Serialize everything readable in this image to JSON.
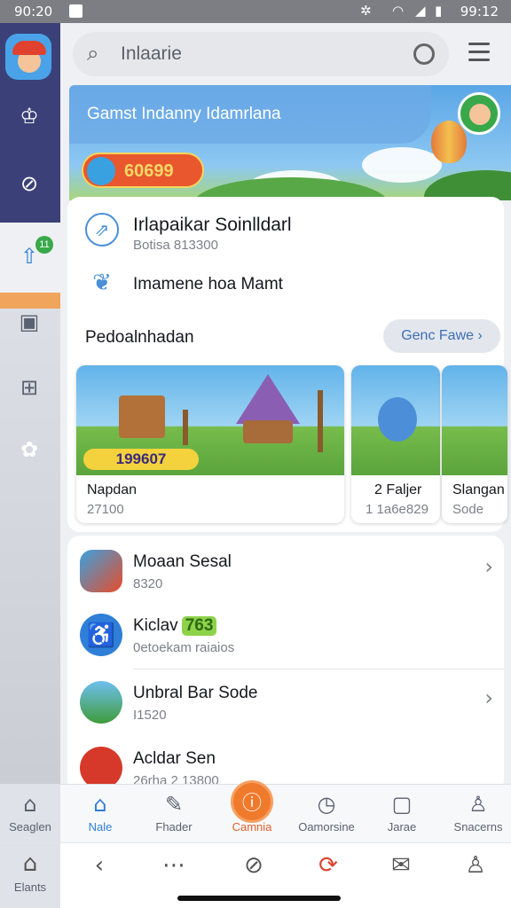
{
  "status_bar": {
    "time_left": "90:20",
    "time_right": "99:12"
  },
  "search": {
    "placeholder": "Inlaarie"
  },
  "banner": {
    "title": "Gamst Indanny Idamrlana",
    "coins": "60699"
  },
  "card": {
    "row1_title": "Irlapaikar Soinlldarl",
    "row1_sub": "Botisa 813300",
    "row2_title": "Imamene hoa Mamt",
    "section_title": "Pedoalnhadan",
    "see_all": "Genc Fawe",
    "games": [
      {
        "name": "Napdan",
        "sub": "27100",
        "score": "199607"
      },
      {
        "name": "2 Faljer",
        "sub": "1 1a6e829"
      },
      {
        "name": "Slangan",
        "sub": "Sode"
      }
    ]
  },
  "list": [
    {
      "name": "Moaan Sesal",
      "sub": "8320"
    },
    {
      "name": "Kiclav",
      "tag": "763",
      "sub": "0etoekam raiaios"
    },
    {
      "name": "Unbral Bar Sode",
      "sub": "I1520"
    },
    {
      "name": "Acldar Sen",
      "sub": "26rha 2 13800"
    }
  ],
  "nav_top": [
    {
      "label": "Seaglen"
    },
    {
      "label": "Nale"
    },
    {
      "label": "Fhader"
    },
    {
      "label": "Camnia"
    },
    {
      "label": "Oamorsine"
    },
    {
      "label": "Jarae"
    },
    {
      "label": "Snacerns"
    }
  ],
  "nav_bottom": {
    "label": "Elants"
  },
  "colors": {
    "rail_dark": "#3b4178",
    "accent_orange": "#f07a2c",
    "accent_blue": "#2f7fd8"
  }
}
